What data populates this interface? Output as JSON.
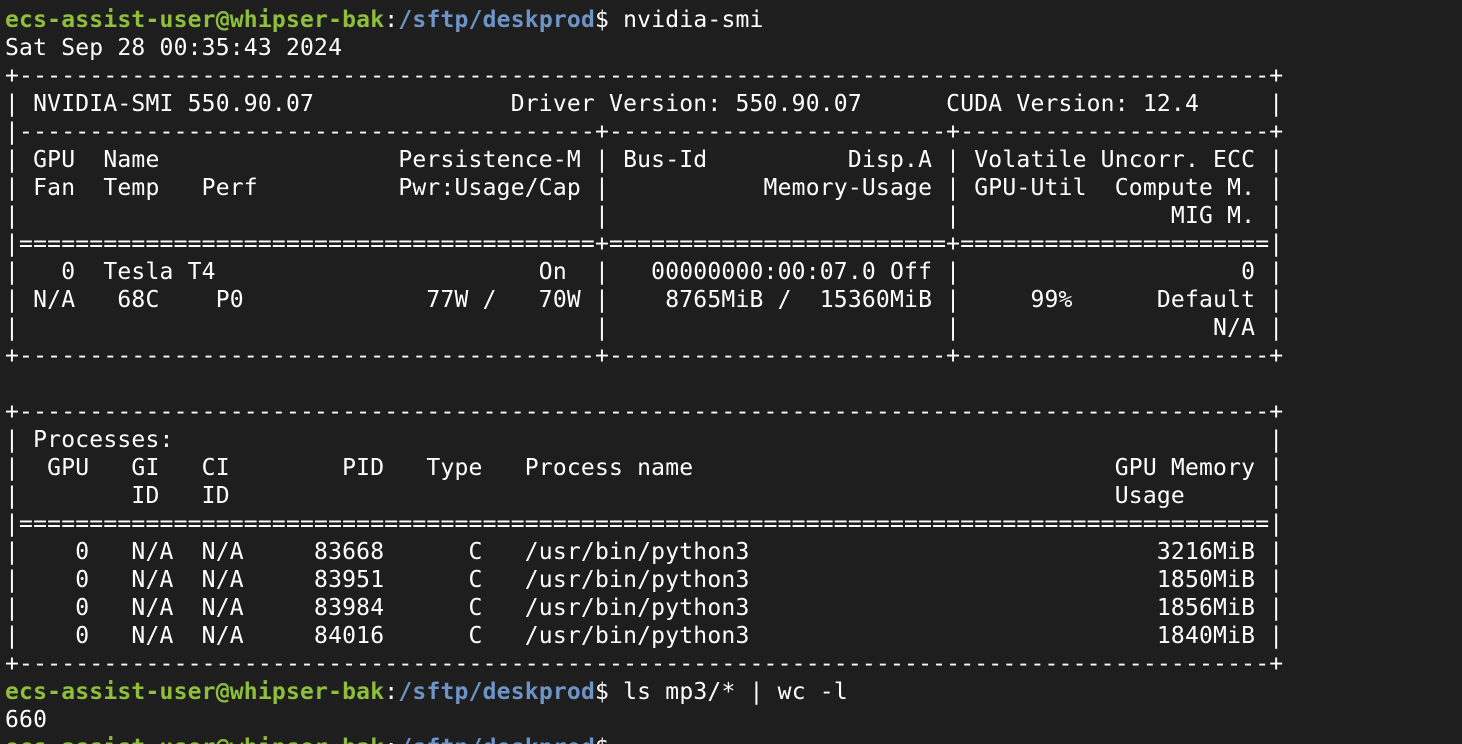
{
  "window": {
    "type": "terminal",
    "colors": {
      "background": "#1e1e1e",
      "text": "#ffffff",
      "prompt_user": "#8fbf3a",
      "prompt_path": "#6e94c7"
    }
  },
  "session": {
    "prompt_user": "ecs-assist-user@whipser-bak",
    "prompt_sep": ":",
    "prompt_path": "/sftp/deskprod",
    "prompt_symbol": "$ ",
    "command1": "nvidia-smi",
    "command2": "ls mp3/* | wc -l",
    "output2": "660"
  },
  "output_lines": [
    "Sat Sep 28 00:35:43 2024",
    "+-----------------------------------------------------------------------------------------+",
    "| NVIDIA-SMI 550.90.07              Driver Version: 550.90.07      CUDA Version: 12.4     |",
    "|-----------------------------------------+------------------------+----------------------+",
    "| GPU  Name                 Persistence-M | Bus-Id          Disp.A | Volatile Uncorr. ECC |",
    "| Fan  Temp   Perf          Pwr:Usage/Cap |           Memory-Usage | GPU-Util  Compute M. |",
    "|                                         |                        |               MIG M. |",
    "|=========================================+========================+======================|",
    "|   0  Tesla T4                       On  |   00000000:00:07.0 Off |                    0 |",
    "| N/A   68C    P0             77W /   70W |    8765MiB /  15360MiB |     99%      Default |",
    "|                                         |                        |                  N/A |",
    "+-----------------------------------------+------------------------+----------------------+",
    "",
    "+-----------------------------------------------------------------------------------------+",
    "| Processes:                                                                              |",
    "|  GPU   GI   CI        PID   Type   Process name                              GPU Memory |",
    "|        ID   ID                                                               Usage      |",
    "|=========================================================================================|",
    "|    0   N/A  N/A     83668      C   /usr/bin/python3                             3216MiB |",
    "|    0   N/A  N/A     83951      C   /usr/bin/python3                             1850MiB |",
    "|    0   N/A  N/A     83984      C   /usr/bin/python3                             1856MiB |",
    "|    0   N/A  N/A     84016      C   /usr/bin/python3                             1840MiB |",
    "+-----------------------------------------------------------------------------------------+"
  ]
}
